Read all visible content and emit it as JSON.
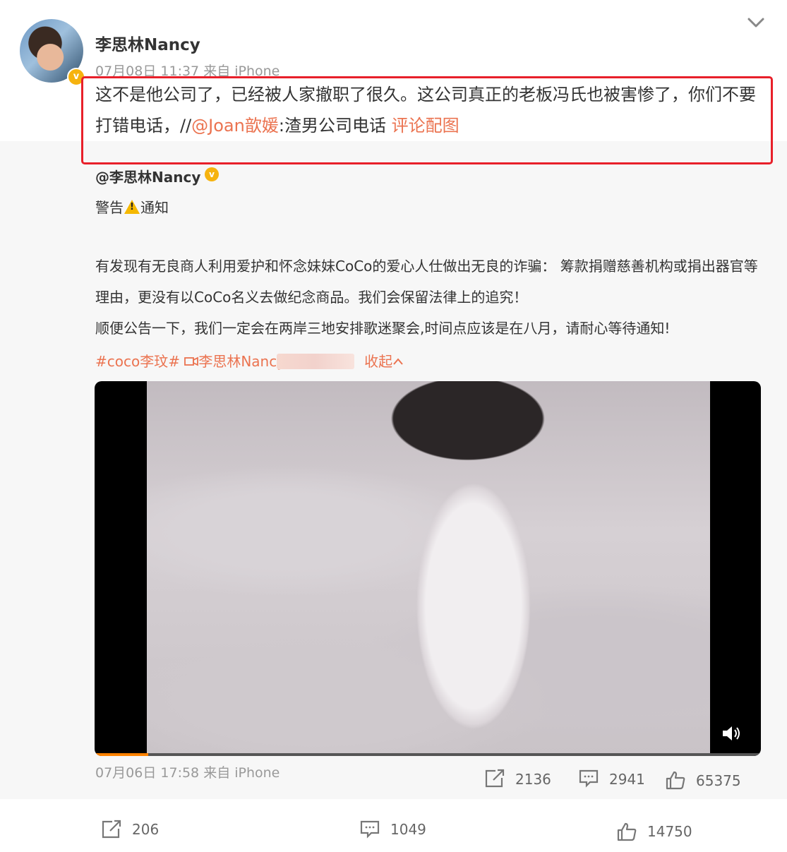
{
  "post": {
    "author": "李思林Nancy",
    "meta": "07月08日 11:37  来自 iPhone",
    "text_before": "这不是他公司了，已经被人家撤职了很久。这公司真正的老板冯氏也被害惨了，你们不要打错电话，//",
    "mention": "@Joan歆媛",
    "text_after": ":渣男公司电话 ",
    "link": "评论配图"
  },
  "repost": {
    "author": "@李思林Nancy",
    "warning_left": "警告",
    "warning_right": "通知",
    "para1": "有发现有无良商人利用爱护和怀念妹妹CoCo的爱心人仕做出无良的诈骗： 筹款捐赠慈善机构或捐出器官等理由，更没有以CoCo名义去做纪念商品。我们会保留法律上的追究！",
    "para2": "顺便公告一下，我们一定会在两岸三地安排歌迷聚会,时间点应该是在八月，请耐心等待通知!",
    "tag": "#coco李玟#",
    "video_link": "李思林Nancy",
    "collapse": "收起",
    "meta": "07月06日 17:58 来自 iPhone",
    "reposts": "2136",
    "comments": "2941",
    "likes": "65375"
  },
  "video": {
    "progress_fraction": 0.08
  },
  "actions": {
    "reposts": "206",
    "comments": "1049",
    "likes": "14750"
  },
  "colors": {
    "link": "#eb7350",
    "highlight_box": "#e8202a",
    "verified": "#f6b30f",
    "progress": "#ff8200"
  },
  "icons": [
    "chevron-down-icon",
    "verified-icon",
    "warning-icon",
    "video-camera-icon",
    "chevron-up-icon",
    "volume-icon",
    "repost-icon",
    "comment-icon",
    "like-icon"
  ]
}
